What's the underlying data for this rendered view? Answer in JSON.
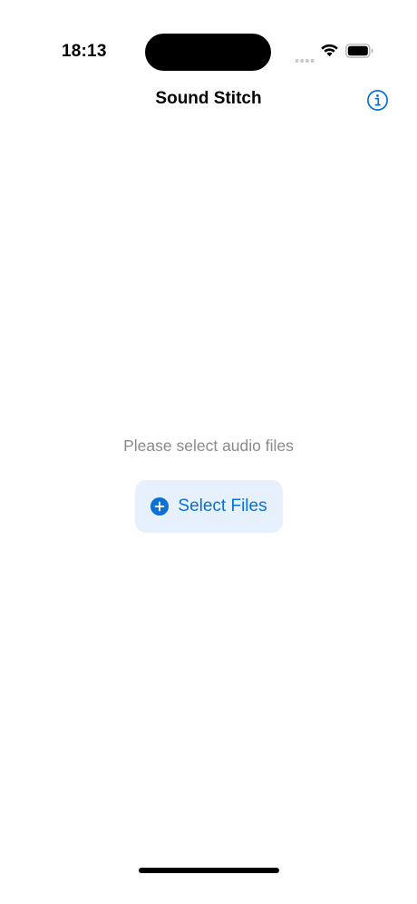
{
  "status_bar": {
    "time": "18:13",
    "icons": [
      "signal-dots-icon",
      "wifi-icon",
      "battery-icon"
    ]
  },
  "nav": {
    "title": "Sound Stitch",
    "info_icon": "info-circle-icon"
  },
  "main": {
    "empty_message": "Please select audio files",
    "select_button": {
      "label": "Select Files",
      "icon": "plus-circle-icon"
    }
  },
  "colors": {
    "accent": "#0a70d6",
    "button_bg": "#e6f1fd",
    "secondary_text": "#8a8a8e"
  }
}
